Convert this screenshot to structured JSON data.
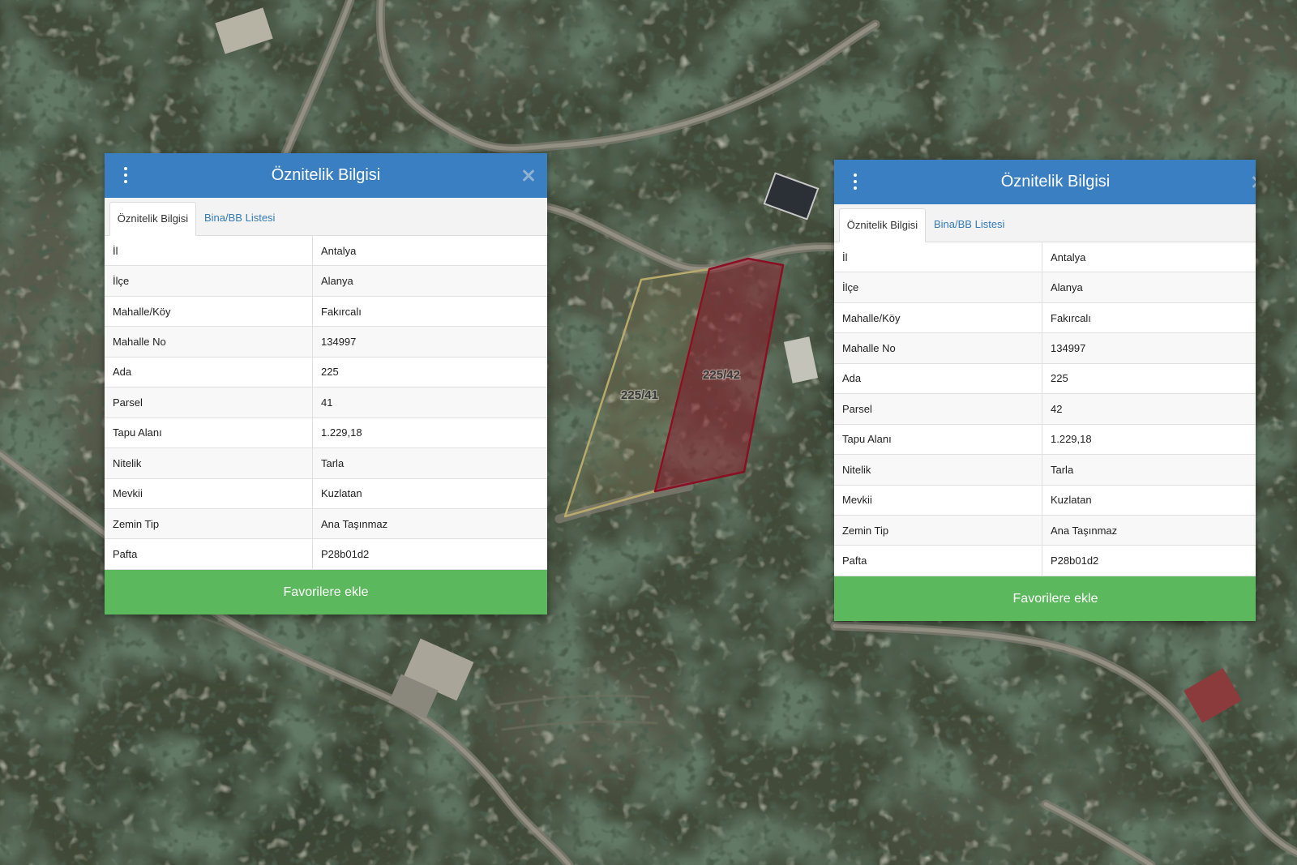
{
  "theme": {
    "header_color": "#3a7fc1",
    "button_color": "#5cb85c",
    "tab_link_color": "#337ab7",
    "parcel_41_outline": "#b8aa6b",
    "parcel_42_outline": "#8a0f22"
  },
  "map": {
    "parcels": [
      {
        "label": "225/41"
      },
      {
        "label": "225/42"
      }
    ]
  },
  "panels": [
    {
      "title": "Öznitelik Bilgisi",
      "menu_icon": "kebab-menu-icon",
      "close_icon": "close-icon",
      "tabs": [
        "Öznitelik Bilgisi",
        "Bina/BB Listesi"
      ],
      "active_tab_index": 0,
      "rows": [
        {
          "label": "İl",
          "value": "Antalya"
        },
        {
          "label": "İlçe",
          "value": "Alanya"
        },
        {
          "label": "Mahalle/Köy",
          "value": "Fakırcalı"
        },
        {
          "label": "Mahalle No",
          "value": "134997"
        },
        {
          "label": "Ada",
          "value": "225"
        },
        {
          "label": "Parsel",
          "value": "41"
        },
        {
          "label": "Tapu Alanı",
          "value": "1.229,18"
        },
        {
          "label": "Nitelik",
          "value": "Tarla"
        },
        {
          "label": "Mevkii",
          "value": "Kuzlatan"
        },
        {
          "label": "Zemin Tip",
          "value": "Ana Taşınmaz"
        },
        {
          "label": "Pafta",
          "value": "P28b01d2"
        }
      ],
      "button_label": "Favorilere ekle"
    },
    {
      "title": "Öznitelik Bilgisi",
      "menu_icon": "kebab-menu-icon",
      "close_icon": "close-icon",
      "tabs": [
        "Öznitelik Bilgisi",
        "Bina/BB Listesi"
      ],
      "active_tab_index": 0,
      "rows": [
        {
          "label": "İl",
          "value": "Antalya"
        },
        {
          "label": "İlçe",
          "value": "Alanya"
        },
        {
          "label": "Mahalle/Köy",
          "value": "Fakırcalı"
        },
        {
          "label": "Mahalle No",
          "value": "134997"
        },
        {
          "label": "Ada",
          "value": "225"
        },
        {
          "label": "Parsel",
          "value": "42"
        },
        {
          "label": "Tapu Alanı",
          "value": "1.229,18"
        },
        {
          "label": "Nitelik",
          "value": "Tarla"
        },
        {
          "label": "Mevkii",
          "value": "Kuzlatan"
        },
        {
          "label": "Zemin Tip",
          "value": "Ana Taşınmaz"
        },
        {
          "label": "Pafta",
          "value": "P28b01d2"
        }
      ],
      "button_label": "Favorilere ekle"
    }
  ]
}
